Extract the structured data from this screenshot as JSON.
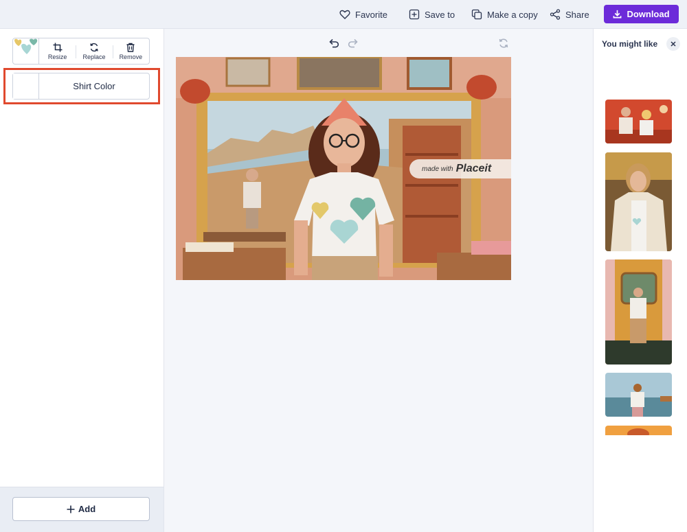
{
  "topbar": {
    "favorite_label": "Favorite",
    "save_to_label": "Save to",
    "make_copy_label": "Make a copy",
    "share_label": "Share",
    "download_label": "Download"
  },
  "left_panel": {
    "tools": [
      {
        "label": "Resize",
        "icon": "crop-icon"
      },
      {
        "label": "Replace",
        "icon": "replace-icon"
      },
      {
        "label": "Remove",
        "icon": "trash-icon"
      }
    ],
    "shirt_color_label": "Shirt Color",
    "add_label": "Add"
  },
  "canvas": {
    "watermark_prefix": "made with",
    "watermark_brand": "Placeit"
  },
  "right_panel": {
    "title": "You might like"
  },
  "colors": {
    "accent": "#6c2bd9",
    "highlight": "#e0492e"
  }
}
